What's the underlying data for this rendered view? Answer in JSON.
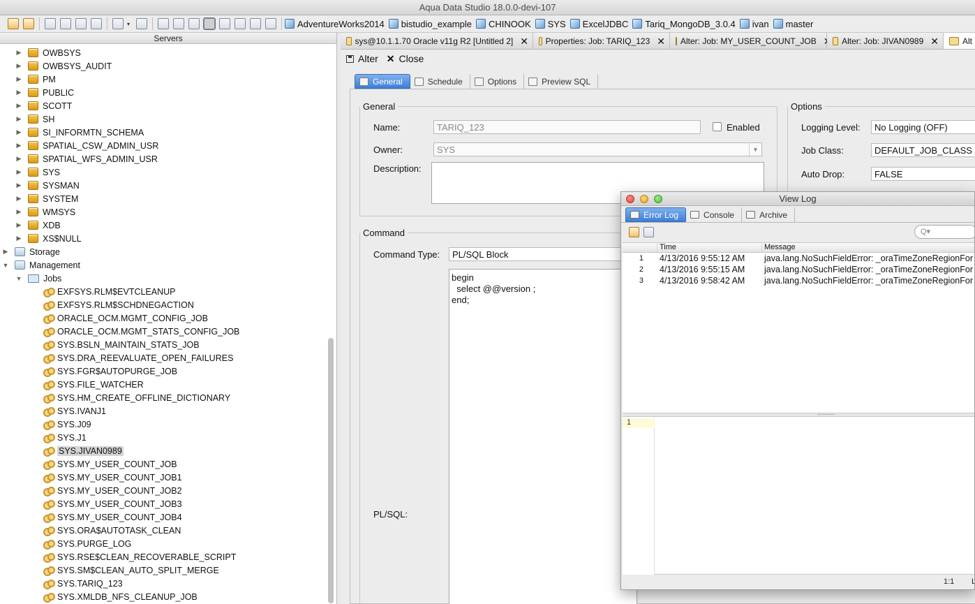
{
  "window": {
    "title": "Aqua Data Studio 18.0.0-devi-107"
  },
  "toolbar": {
    "connections": [
      "AdventureWorks2014",
      "bistudio_example",
      "CHINOOK",
      "SYS",
      "ExcelJDBC",
      "Tariq_MongoDB_3.0.4",
      "ivan",
      "master"
    ]
  },
  "servers": {
    "header": "Servers",
    "schemas": [
      "OWBSYS",
      "OWBSYS_AUDIT",
      "PM",
      "PUBLIC",
      "SCOTT",
      "SH",
      "SI_INFORMTN_SCHEMA",
      "SPATIAL_CSW_ADMIN_USR",
      "SPATIAL_WFS_ADMIN_USR",
      "SYS",
      "SYSMAN",
      "SYSTEM",
      "WMSYS",
      "XDB",
      "XS$NULL"
    ],
    "storage": "Storage",
    "management": "Management",
    "jobs_folder": "Jobs",
    "jobs": [
      "EXFSYS.RLM$EVTCLEANUP",
      "EXFSYS.RLM$SCHDNEGACTION",
      "ORACLE_OCM.MGMT_CONFIG_JOB",
      "ORACLE_OCM.MGMT_STATS_CONFIG_JOB",
      "SYS.BSLN_MAINTAIN_STATS_JOB",
      "SYS.DRA_REEVALUATE_OPEN_FAILURES",
      "SYS.FGR$AUTOPURGE_JOB",
      "SYS.FILE_WATCHER",
      "SYS.HM_CREATE_OFFLINE_DICTIONARY",
      "SYS.IVANJ1",
      "SYS.J09",
      "SYS.J1",
      "SYS.JIVAN0989",
      "SYS.MY_USER_COUNT_JOB",
      "SYS.MY_USER_COUNT_JOB1",
      "SYS.MY_USER_COUNT_JOB2",
      "SYS.MY_USER_COUNT_JOB3",
      "SYS.MY_USER_COUNT_JOB4",
      "SYS.ORA$AUTOTASK_CLEAN",
      "SYS.PURGE_LOG",
      "SYS.RSE$CLEAN_RECOVERABLE_SCRIPT",
      "SYS.SM$CLEAN_AUTO_SPLIT_MERGE",
      "SYS.TARIQ_123",
      "SYS.XMLDB_NFS_CLEANUP_JOB"
    ],
    "selected_job": "SYS.JIVAN0989"
  },
  "tabs": [
    {
      "label": "sys@10.1.1.70 Oracle  v11g R2 [Untitled 2]"
    },
    {
      "label": "Properties: Job: TARIQ_123"
    },
    {
      "label": "Alter: Job: MY_USER_COUNT_JOB"
    },
    {
      "label": "Alter: Job: JIVAN0989"
    },
    {
      "label": "Alt"
    }
  ],
  "tab_close": "✕",
  "actions": {
    "alter": "Alter",
    "close": "Close"
  },
  "subtabs": [
    "General",
    "Schedule",
    "Options",
    "Preview SQL"
  ],
  "general": {
    "legend": "General",
    "name_label": "Name:",
    "name_value": "TARIQ_123",
    "enabled_label": "Enabled",
    "owner_label": "Owner:",
    "owner_value": "SYS",
    "description_label": "Description:"
  },
  "options": {
    "legend": "Options",
    "logging_label": "Logging Level:",
    "logging_value": "No Logging (OFF)",
    "jobclass_label": "Job Class:",
    "jobclass_value": "DEFAULT_JOB_CLASS",
    "autodrop_label": "Auto Drop:",
    "autodrop_value": "FALSE"
  },
  "command": {
    "legend": "Command",
    "type_label": "Command Type:",
    "type_value": "PL/SQL Block",
    "plsql_label": "PL/SQL:",
    "plsql_code": "begin\n  select @@version ;\nend;"
  },
  "viewlog": {
    "title": "View Log",
    "tabs": [
      "Error Log",
      "Console",
      "Archive"
    ],
    "columns": {
      "time": "Time",
      "message": "Message"
    },
    "rows": [
      {
        "num": "1",
        "time": "4/13/2016 9:55:12 AM",
        "message": "java.lang.NoSuchFieldError: _oraTimeZoneRegionFor"
      },
      {
        "num": "2",
        "time": "4/13/2016 9:55:15 AM",
        "message": "java.lang.NoSuchFieldError: _oraTimeZoneRegionFor"
      },
      {
        "num": "3",
        "time": "4/13/2016 9:58:42 AM",
        "message": "java.lang.NoSuchFieldError: _oraTimeZoneRegionFor"
      }
    ],
    "editor_line": "1",
    "search_glyph": "Q▾",
    "status_pos": "1:1",
    "status_right": "L"
  }
}
